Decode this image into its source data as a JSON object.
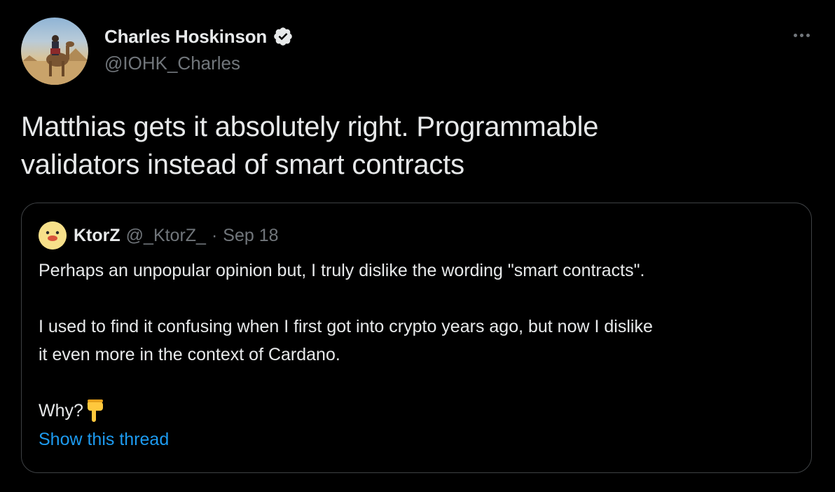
{
  "author": {
    "display_name": "Charles Hoskinson",
    "handle": "@IOHK_Charles",
    "verified": true,
    "avatar_icon": "camel-rider-pyramids-photo"
  },
  "tweet": {
    "text_line1": "Matthias gets it absolutely right. Programmable",
    "text_line2": "validators instead of smart contracts"
  },
  "menu": {
    "icon": "more-horizontal-icon"
  },
  "quoted_tweet": {
    "display_name": "KtorZ",
    "handle": "@_KtorZ_",
    "separator": "·",
    "date": "Sep 18",
    "avatar_icon": "duck-face-icon",
    "paragraph1": "Perhaps an unpopular opinion but, I truly dislike the wording \"smart contracts\".",
    "paragraph2_line1": "I used to find it confusing when I first got into crypto years ago, but now I dislike",
    "paragraph2_line2": "it even more in the context of Cardano.",
    "why_text": "Why?",
    "why_emoji": "pointing-down-emoji",
    "show_thread": "Show this thread"
  },
  "colors": {
    "background": "#000000",
    "primary_text": "#e7e9ea",
    "secondary_text": "#71767b",
    "link": "#1d9bf0",
    "border": "#3e4144"
  }
}
